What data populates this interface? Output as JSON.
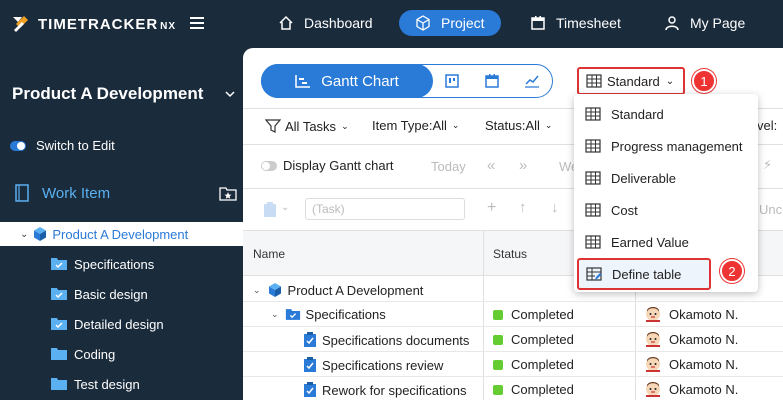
{
  "app": {
    "logo_text": "TIMETRACKER",
    "logo_suffix": "NX"
  },
  "nav": {
    "items": [
      {
        "label": "Dashboard",
        "icon": "home-icon"
      },
      {
        "label": "Project",
        "icon": "cube-icon",
        "active": true
      },
      {
        "label": "Timesheet",
        "icon": "calendar-icon"
      },
      {
        "label": "My Page",
        "icon": "user-icon"
      }
    ]
  },
  "sidebar": {
    "project_title": "Product A Development",
    "switch_label": "Switch to Edit",
    "work_item_label": "Work Item",
    "tree_root": "Product A Development",
    "tree_items": [
      "Specifications",
      "Basic design",
      "Detailed design",
      "Coding",
      "Test design"
    ]
  },
  "toolbar": {
    "gantt_label": "Gantt Chart",
    "view_dropdown": "Standard",
    "callout_1": "1",
    "callout_2": "2"
  },
  "filters": {
    "all_tasks": "All Tasks",
    "item_type": "Item Type:All",
    "status": "Status:All",
    "level_partial": "vel:"
  },
  "gantt_controls": {
    "display_gantt": "Display Gantt chart",
    "today": "Today",
    "we_partial": "We",
    "task_placeholder": "(Task)",
    "unc_partial": "Unc"
  },
  "table": {
    "headers": {
      "name": "Name",
      "status": "Status"
    },
    "rows": [
      {
        "name": "Product A Development",
        "status": "",
        "assignee": "",
        "level": 0
      },
      {
        "name": "Specifications",
        "status": "Completed",
        "assignee": "Okamoto N.",
        "level": 1
      },
      {
        "name": "Specifications documents",
        "status": "Completed",
        "assignee": "Okamoto N.",
        "level": 2
      },
      {
        "name": "Specifications review",
        "status": "Completed",
        "assignee": "Okamoto N.",
        "level": 2
      },
      {
        "name": "Rework for specifications",
        "status": "Completed",
        "assignee": "Okamoto N.",
        "level": 2
      }
    ]
  },
  "menu": {
    "items": [
      "Standard",
      "Progress management",
      "Deliverable",
      "Cost",
      "Earned Value",
      "Define table"
    ]
  },
  "colors": {
    "accent": "#2a7ad8",
    "sidebar_bg": "#1a2b3c",
    "highlight_red": "#dd3333",
    "completed": "#66cc33"
  }
}
